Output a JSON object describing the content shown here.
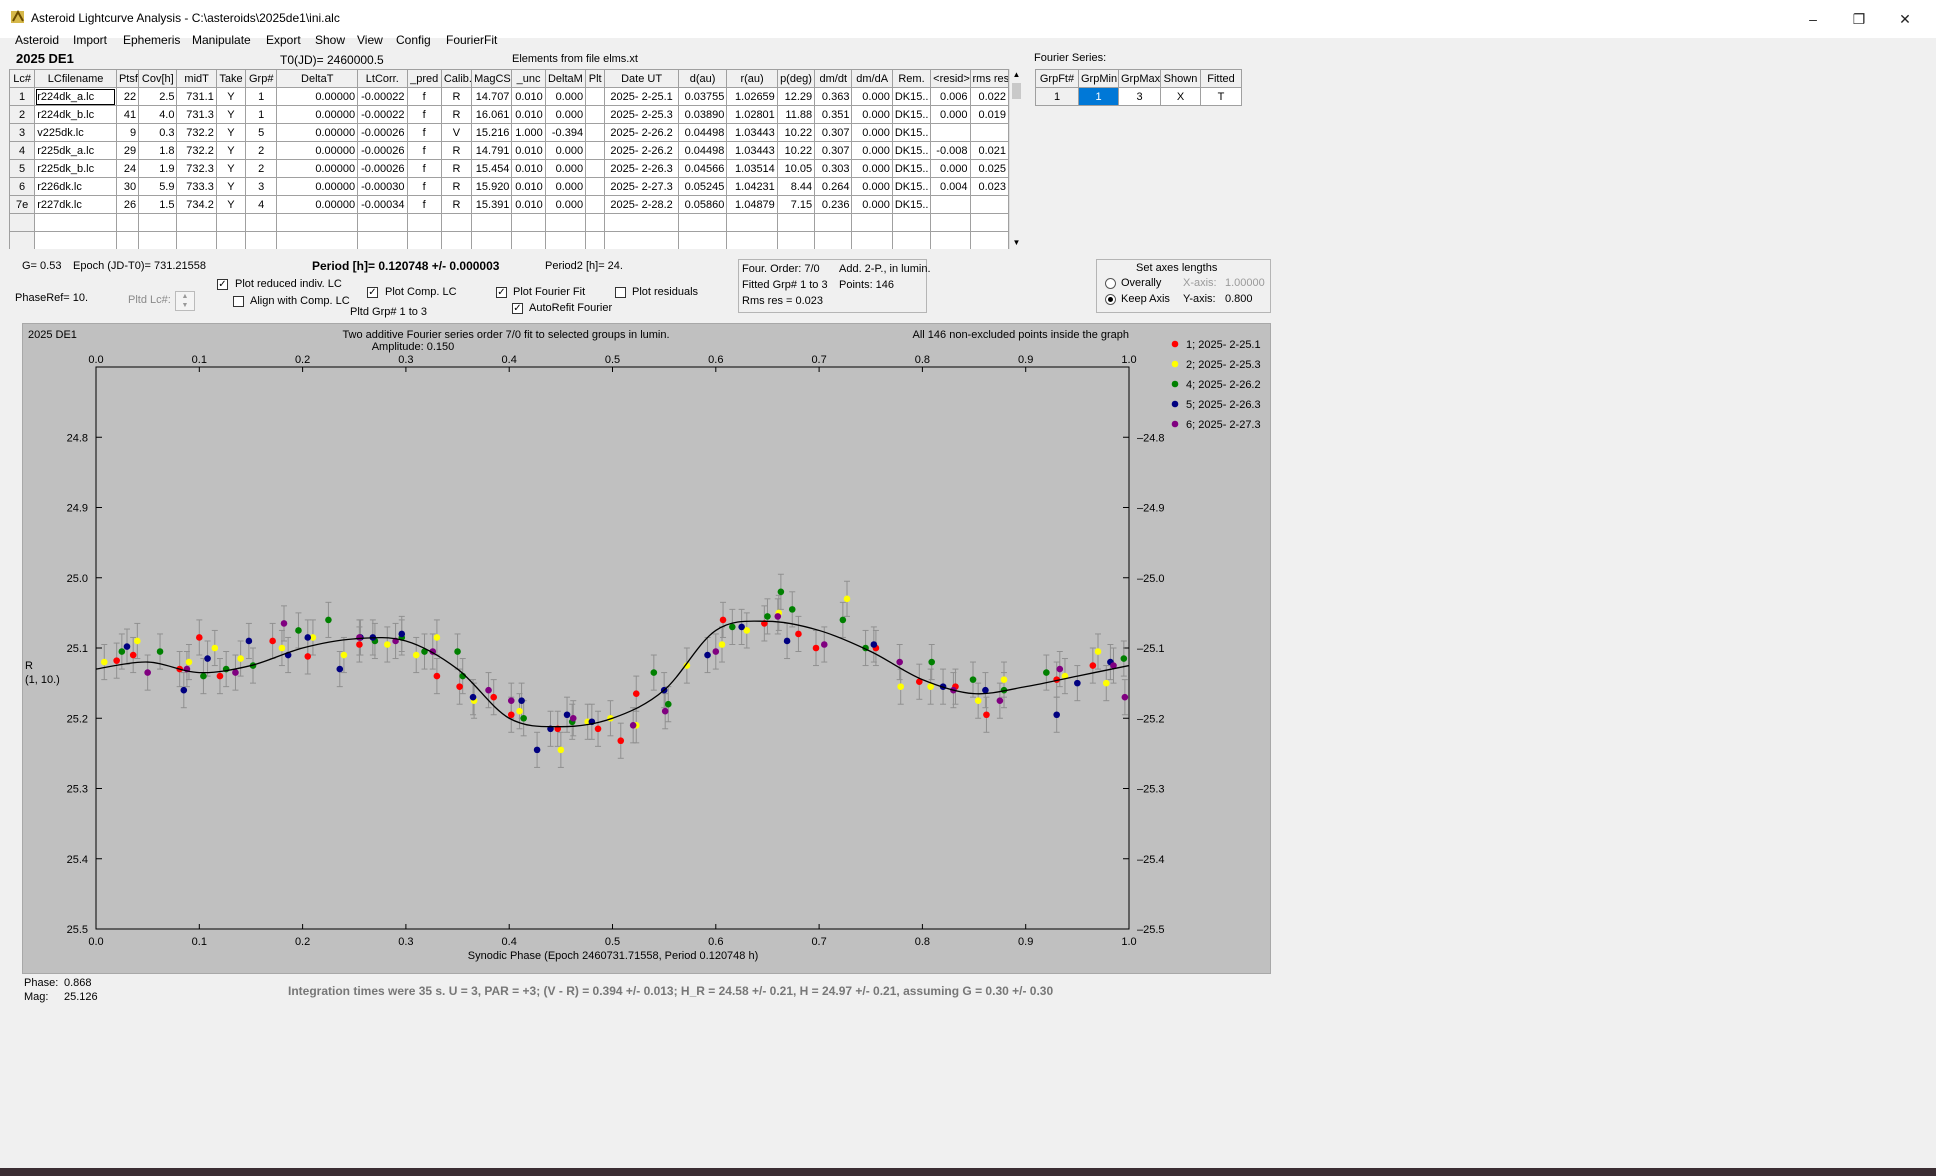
{
  "window": {
    "title": "Asteroid Lightcurve Analysis - C:\\asteroids\\2025de1\\ini.alc",
    "controls": [
      "minimize",
      "restore",
      "close"
    ]
  },
  "menu": [
    "Asteroid",
    "Import",
    "Ephemeris",
    "Manipulate",
    "Export",
    "Show",
    "View",
    "Config",
    "FourierFit"
  ],
  "header": {
    "object": "2025 DE1",
    "t0": "T0(JD)= 2460000.5",
    "elements": "Elements from file elms.xt",
    "fourier_series": "Fourier Series:"
  },
  "lc_table": {
    "columns": [
      "Lc#",
      "LCfilename",
      "Ptsf",
      "Cov[h]",
      "midT",
      "Take",
      "Grp#",
      "DeltaT",
      "LtCorr.",
      "_pred",
      "Calib.",
      "MagCS",
      "_unc",
      "DeltaM",
      "Plt",
      "Date UT",
      "d(au)",
      "r(au)",
      "p(deg)",
      "dm/dt",
      "dm/dA",
      "Rem.",
      "<resid>",
      "rms res"
    ],
    "rows": [
      [
        "1",
        "r224dk_a.lc",
        "22",
        "2.5",
        "731.1",
        "Y",
        "1",
        "0.00000",
        "-0.00022",
        "f",
        "R",
        "14.707",
        "0.010",
        "0.000",
        "",
        "2025- 2-25.1",
        "0.03755",
        "1.02659",
        "12.29",
        "0.363",
        "0.000",
        "DK15..",
        "0.006",
        "0.022"
      ],
      [
        "2",
        "r224dk_b.lc",
        "41",
        "4.0",
        "731.3",
        "Y",
        "1",
        "0.00000",
        "-0.00022",
        "f",
        "R",
        "16.061",
        "0.010",
        "0.000",
        "",
        "2025- 2-25.3",
        "0.03890",
        "1.02801",
        "11.88",
        "0.351",
        "0.000",
        "DK15..",
        "0.000",
        "0.019"
      ],
      [
        "3",
        "v225dk.lc",
        "9",
        "0.3",
        "732.2",
        "Y",
        "5",
        "0.00000",
        "-0.00026",
        "f",
        "V",
        "15.216",
        "1.000",
        "-0.394",
        "",
        "2025- 2-26.2",
        "0.04498",
        "1.03443",
        "10.22",
        "0.307",
        "0.000",
        "DK15..",
        "",
        ""
      ],
      [
        "4",
        "r225dk_a.lc",
        "29",
        "1.8",
        "732.2",
        "Y",
        "2",
        "0.00000",
        "-0.00026",
        "f",
        "R",
        "14.791",
        "0.010",
        "0.000",
        "",
        "2025- 2-26.2",
        "0.04498",
        "1.03443",
        "10.22",
        "0.307",
        "0.000",
        "DK15..",
        "-0.008",
        "0.021"
      ],
      [
        "5",
        "r225dk_b.lc",
        "24",
        "1.9",
        "732.3",
        "Y",
        "2",
        "0.00000",
        "-0.00026",
        "f",
        "R",
        "15.454",
        "0.010",
        "0.000",
        "",
        "2025- 2-26.3",
        "0.04566",
        "1.03514",
        "10.05",
        "0.303",
        "0.000",
        "DK15..",
        "0.000",
        "0.025"
      ],
      [
        "6",
        "r226dk.lc",
        "30",
        "5.9",
        "733.3",
        "Y",
        "3",
        "0.00000",
        "-0.00030",
        "f",
        "R",
        "15.920",
        "0.010",
        "0.000",
        "",
        "2025- 2-27.3",
        "0.05245",
        "1.04231",
        "8.44",
        "0.264",
        "0.000",
        "DK15..",
        "0.004",
        "0.023"
      ],
      [
        "7e",
        "r227dk.lc",
        "26",
        "1.5",
        "734.2",
        "Y",
        "4",
        "0.00000",
        "-0.00034",
        "f",
        "R",
        "15.391",
        "0.010",
        "0.000",
        "",
        "2025- 2-28.2",
        "0.05860",
        "1.04879",
        "7.15",
        "0.236",
        "0.000",
        "DK15..",
        "",
        ""
      ]
    ]
  },
  "fourier_table": {
    "columns": [
      "GrpFt#",
      "GrpMin",
      "GrpMax",
      "Shown",
      "Fitted"
    ],
    "row": [
      "1",
      "1",
      "3",
      "X",
      "T"
    ]
  },
  "info": {
    "g": "G= 0.53",
    "epoch": "Epoch (JD-T0)= 731.21558",
    "period": "Period [h]= 0.120748 +/- 0.000003",
    "period2": "Period2 [h]= 24.",
    "phaseref": "PhaseRef= 10.",
    "pltd_lc": "Pltd Lc#:",
    "pltd_grp": "Pltd Grp#  1  to  3"
  },
  "checkboxes": {
    "plot_reduced": {
      "label": "Plot reduced indiv. LC",
      "checked": true
    },
    "align_comp": {
      "label": "Align with Comp. LC",
      "checked": false
    },
    "plot_comp": {
      "label": "Plot Comp. LC",
      "checked": true
    },
    "plot_fourier": {
      "label": "Plot Fourier Fit",
      "checked": true
    },
    "autorefit": {
      "label": "AutoRefit Fourier",
      "checked": true
    },
    "plot_residuals": {
      "label": "Plot residuals",
      "checked": false
    }
  },
  "fit_box": {
    "order": "Four. Order:  7/0",
    "add": "Add. 2-P., in lumin.",
    "fitted": "Fitted Grp# 1 to 3",
    "points": "Points: 146",
    "rms": "Rms res     = 0.023"
  },
  "axes_box": {
    "title": "Set axes lengths",
    "overall": "Overally",
    "keep": "Keep Axis",
    "x_label": "X-axis:",
    "x_value": "1.00000",
    "y_label": "Y-axis:",
    "y_value": "0.800",
    "selected": "keep"
  },
  "plot": {
    "corner": "2025 DE1",
    "title": "Two additive Fourier series order 7/0 fit to selected groups in lumin.",
    "amplitude": "Amplitude: 0.150",
    "note": "All 146 non-excluded points inside the graph",
    "ylabel_1": "R",
    "ylabel_2": "(1, 10.)",
    "xlabel": "Synodic Phase (Epoch 2460731.71558, Period 0.120748 h)"
  },
  "chart_data": {
    "type": "scatter",
    "xlim": [
      0,
      1
    ],
    "ylim": [
      24.7,
      25.5
    ],
    "y_inverted": true,
    "x_ticks": [
      "0.0",
      "0.1",
      "0.2",
      "0.3",
      "0.4",
      "0.5",
      "0.6",
      "0.7",
      "0.8",
      "0.9",
      "1.0"
    ],
    "y_ticks": [
      "24.8",
      "24.9",
      "25.0",
      "25.1",
      "25.2",
      "25.3",
      "25.4",
      "25.5"
    ],
    "legend": [
      {
        "name": "1; 2025- 2-25.1",
        "color": "#ff0000"
      },
      {
        "name": "2; 2025- 2-25.3",
        "color": "#ffff00"
      },
      {
        "name": "4; 2025- 2-26.2",
        "color": "#008000"
      },
      {
        "name": "5; 2025- 2-26.3",
        "color": "#000080"
      },
      {
        "name": "6; 2025- 2-27.3",
        "color": "#800080"
      }
    ],
    "curve": [
      [
        0.0,
        25.13
      ],
      [
        0.05,
        25.12
      ],
      [
        0.1,
        25.135
      ],
      [
        0.15,
        25.125
      ],
      [
        0.2,
        25.1
      ],
      [
        0.25,
        25.087
      ],
      [
        0.3,
        25.09
      ],
      [
        0.35,
        25.13
      ],
      [
        0.4,
        25.2
      ],
      [
        0.45,
        25.212
      ],
      [
        0.5,
        25.2
      ],
      [
        0.55,
        25.16
      ],
      [
        0.6,
        25.075
      ],
      [
        0.65,
        25.062
      ],
      [
        0.7,
        25.075
      ],
      [
        0.75,
        25.105
      ],
      [
        0.8,
        25.145
      ],
      [
        0.85,
        25.165
      ],
      [
        0.9,
        25.155
      ],
      [
        0.95,
        25.14
      ],
      [
        1.0,
        25.125
      ]
    ],
    "points": [
      [
        0.02,
        25.118,
        0
      ],
      [
        0.036,
        25.11,
        0
      ],
      [
        0.081,
        25.13,
        0
      ],
      [
        0.1,
        25.085,
        0
      ],
      [
        0.12,
        25.14,
        0
      ],
      [
        0.171,
        25.09,
        0
      ],
      [
        0.205,
        25.112,
        0
      ],
      [
        0.255,
        25.095,
        0
      ],
      [
        0.33,
        25.14,
        0
      ],
      [
        0.352,
        25.155,
        0
      ],
      [
        0.385,
        25.17,
        0
      ],
      [
        0.402,
        25.195,
        0
      ],
      [
        0.447,
        25.215,
        0
      ],
      [
        0.486,
        25.215,
        0
      ],
      [
        0.508,
        25.232,
        0
      ],
      [
        0.523,
        25.165,
        0
      ],
      [
        0.607,
        25.06,
        0
      ],
      [
        0.647,
        25.065,
        0
      ],
      [
        0.68,
        25.08,
        0
      ],
      [
        0.697,
        25.1,
        0
      ],
      [
        0.755,
        25.1,
        0
      ],
      [
        0.797,
        25.148,
        0
      ],
      [
        0.832,
        25.155,
        0
      ],
      [
        0.862,
        25.195,
        0
      ],
      [
        0.93,
        25.145,
        0
      ],
      [
        0.965,
        25.125,
        0
      ],
      [
        0.008,
        25.12,
        1
      ],
      [
        0.04,
        25.09,
        1
      ],
      [
        0.09,
        25.12,
        1
      ],
      [
        0.115,
        25.1,
        1
      ],
      [
        0.14,
        25.115,
        1
      ],
      [
        0.18,
        25.1,
        1
      ],
      [
        0.21,
        25.085,
        1
      ],
      [
        0.24,
        25.11,
        1
      ],
      [
        0.282,
        25.095,
        1
      ],
      [
        0.31,
        25.11,
        1
      ],
      [
        0.33,
        25.085,
        1
      ],
      [
        0.366,
        25.175,
        1
      ],
      [
        0.41,
        25.19,
        1
      ],
      [
        0.45,
        25.245,
        1
      ],
      [
        0.476,
        25.205,
        1
      ],
      [
        0.498,
        25.2,
        1
      ],
      [
        0.523,
        25.21,
        1
      ],
      [
        0.572,
        25.125,
        1
      ],
      [
        0.606,
        25.095,
        1
      ],
      [
        0.63,
        25.075,
        1
      ],
      [
        0.661,
        25.05,
        1
      ],
      [
        0.727,
        25.03,
        1
      ],
      [
        0.779,
        25.155,
        1
      ],
      [
        0.808,
        25.155,
        1
      ],
      [
        0.854,
        25.175,
        1
      ],
      [
        0.879,
        25.145,
        1
      ],
      [
        0.938,
        25.14,
        1
      ],
      [
        0.97,
        25.105,
        1
      ],
      [
        0.978,
        25.15,
        1
      ],
      [
        0.025,
        25.105,
        2
      ],
      [
        0.062,
        25.105,
        2
      ],
      [
        0.104,
        25.14,
        2
      ],
      [
        0.126,
        25.13,
        2
      ],
      [
        0.152,
        25.125,
        2
      ],
      [
        0.196,
        25.075,
        2
      ],
      [
        0.225,
        25.06,
        2
      ],
      [
        0.27,
        25.09,
        2
      ],
      [
        0.296,
        25.085,
        2
      ],
      [
        0.318,
        25.105,
        2
      ],
      [
        0.35,
        25.105,
        2
      ],
      [
        0.355,
        25.14,
        2
      ],
      [
        0.414,
        25.2,
        2
      ],
      [
        0.461,
        25.205,
        2
      ],
      [
        0.54,
        25.135,
        2
      ],
      [
        0.554,
        25.18,
        2
      ],
      [
        0.616,
        25.07,
        2
      ],
      [
        0.65,
        25.055,
        2
      ],
      [
        0.663,
        25.02,
        2
      ],
      [
        0.674,
        25.045,
        2
      ],
      [
        0.723,
        25.06,
        2
      ],
      [
        0.745,
        25.1,
        2
      ],
      [
        0.809,
        25.12,
        2
      ],
      [
        0.849,
        25.145,
        2
      ],
      [
        0.879,
        25.16,
        2
      ],
      [
        0.92,
        25.135,
        2
      ],
      [
        0.995,
        25.115,
        2
      ],
      [
        0.03,
        25.098,
        3
      ],
      [
        0.085,
        25.16,
        3
      ],
      [
        0.108,
        25.115,
        3
      ],
      [
        0.148,
        25.09,
        3
      ],
      [
        0.186,
        25.11,
        3
      ],
      [
        0.205,
        25.085,
        3
      ],
      [
        0.236,
        25.13,
        3
      ],
      [
        0.256,
        25.085,
        3
      ],
      [
        0.268,
        25.085,
        3
      ],
      [
        0.296,
        25.08,
        3
      ],
      [
        0.365,
        25.17,
        3
      ],
      [
        0.412,
        25.175,
        3
      ],
      [
        0.427,
        25.245,
        3
      ],
      [
        0.44,
        25.215,
        3
      ],
      [
        0.456,
        25.195,
        3
      ],
      [
        0.48,
        25.205,
        3
      ],
      [
        0.55,
        25.16,
        3
      ],
      [
        0.592,
        25.11,
        3
      ],
      [
        0.625,
        25.07,
        3
      ],
      [
        0.669,
        25.09,
        3
      ],
      [
        0.753,
        25.095,
        3
      ],
      [
        0.82,
        25.155,
        3
      ],
      [
        0.861,
        25.16,
        3
      ],
      [
        0.93,
        25.195,
        3
      ],
      [
        0.95,
        25.15,
        3
      ],
      [
        0.982,
        25.12,
        3
      ],
      [
        0.05,
        25.135,
        4
      ],
      [
        0.088,
        25.13,
        4
      ],
      [
        0.135,
        25.135,
        4
      ],
      [
        0.182,
        25.065,
        4
      ],
      [
        0.255,
        25.085,
        4
      ],
      [
        0.29,
        25.09,
        4
      ],
      [
        0.326,
        25.105,
        4
      ],
      [
        0.38,
        25.16,
        4
      ],
      [
        0.402,
        25.175,
        4
      ],
      [
        0.462,
        25.2,
        4
      ],
      [
        0.52,
        25.21,
        4
      ],
      [
        0.551,
        25.19,
        4
      ],
      [
        0.6,
        25.105,
        4
      ],
      [
        0.66,
        25.055,
        4
      ],
      [
        0.705,
        25.095,
        4
      ],
      [
        0.778,
        25.12,
        4
      ],
      [
        0.83,
        25.16,
        4
      ],
      [
        0.875,
        25.175,
        4
      ],
      [
        0.933,
        25.13,
        4
      ],
      [
        0.985,
        25.125,
        4
      ],
      [
        0.996,
        25.17,
        4
      ]
    ]
  },
  "readout": {
    "phase_label": "Phase:",
    "phase_value": "0.868",
    "mag_label": "Mag:",
    "mag_value": "25.126"
  },
  "footer_note": "Integration times were 35 s.  U = 3, PAR = +3; (V - R) = 0.394 +/- 0.013; H_R = 24.58 +/- 0.21, H = 24.97 +/- 0.21, assuming G = 0.30 +/- 0.30"
}
